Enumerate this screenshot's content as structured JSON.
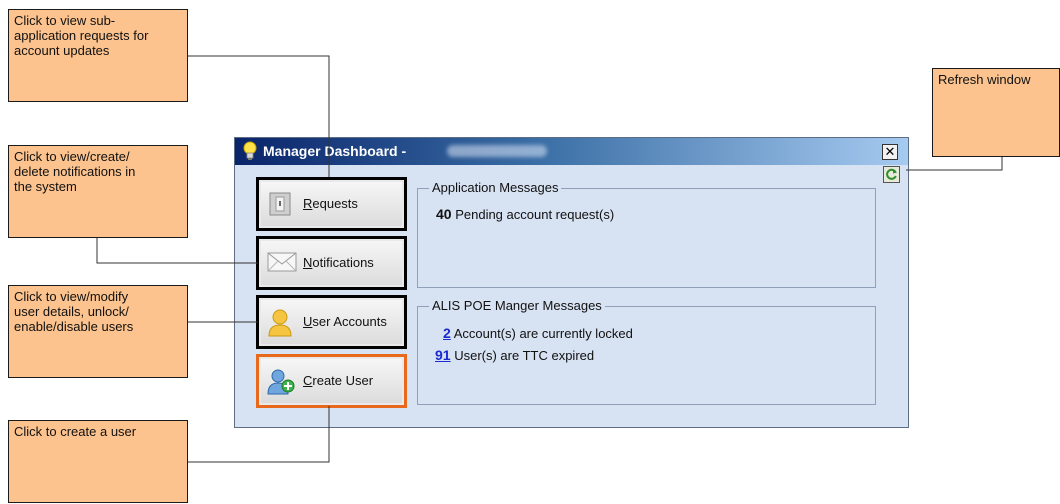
{
  "callouts": {
    "requests": "Click to view sub-\napplication requests for\naccount updates",
    "notifications": "Click to view/create/\ndelete notifications in\nthe system",
    "user_accounts": "Click to view/modify\nuser details, unlock/\nenable/disable users",
    "create_user": "Click to create a user",
    "refresh": "Refresh window"
  },
  "window": {
    "title": "Manager Dashboard -",
    "close_label": "✕"
  },
  "buttons": {
    "requests": "Requests",
    "notifications": "Notifications",
    "user_accounts": "User Accounts",
    "create_user": "Create User"
  },
  "application_messages": {
    "title": "Application Messages",
    "count": "40",
    "text": "Pending account request(s)"
  },
  "alis_messages": {
    "title": "ALIS POE Manger Messages",
    "items": [
      {
        "count": "2",
        "text": "Account(s) are currently locked"
      },
      {
        "count": "91",
        "text": "User(s) are TTC expired"
      }
    ]
  },
  "colors": {
    "callout_fill": "#fcc38e",
    "highlight_border": "#e8691c",
    "link": "#1a2bd1"
  },
  "icons": [
    "lightbulb-icon",
    "door-icon",
    "envelope-icon",
    "user-icon",
    "add-user-icon",
    "refresh-icon",
    "close-icon"
  ]
}
